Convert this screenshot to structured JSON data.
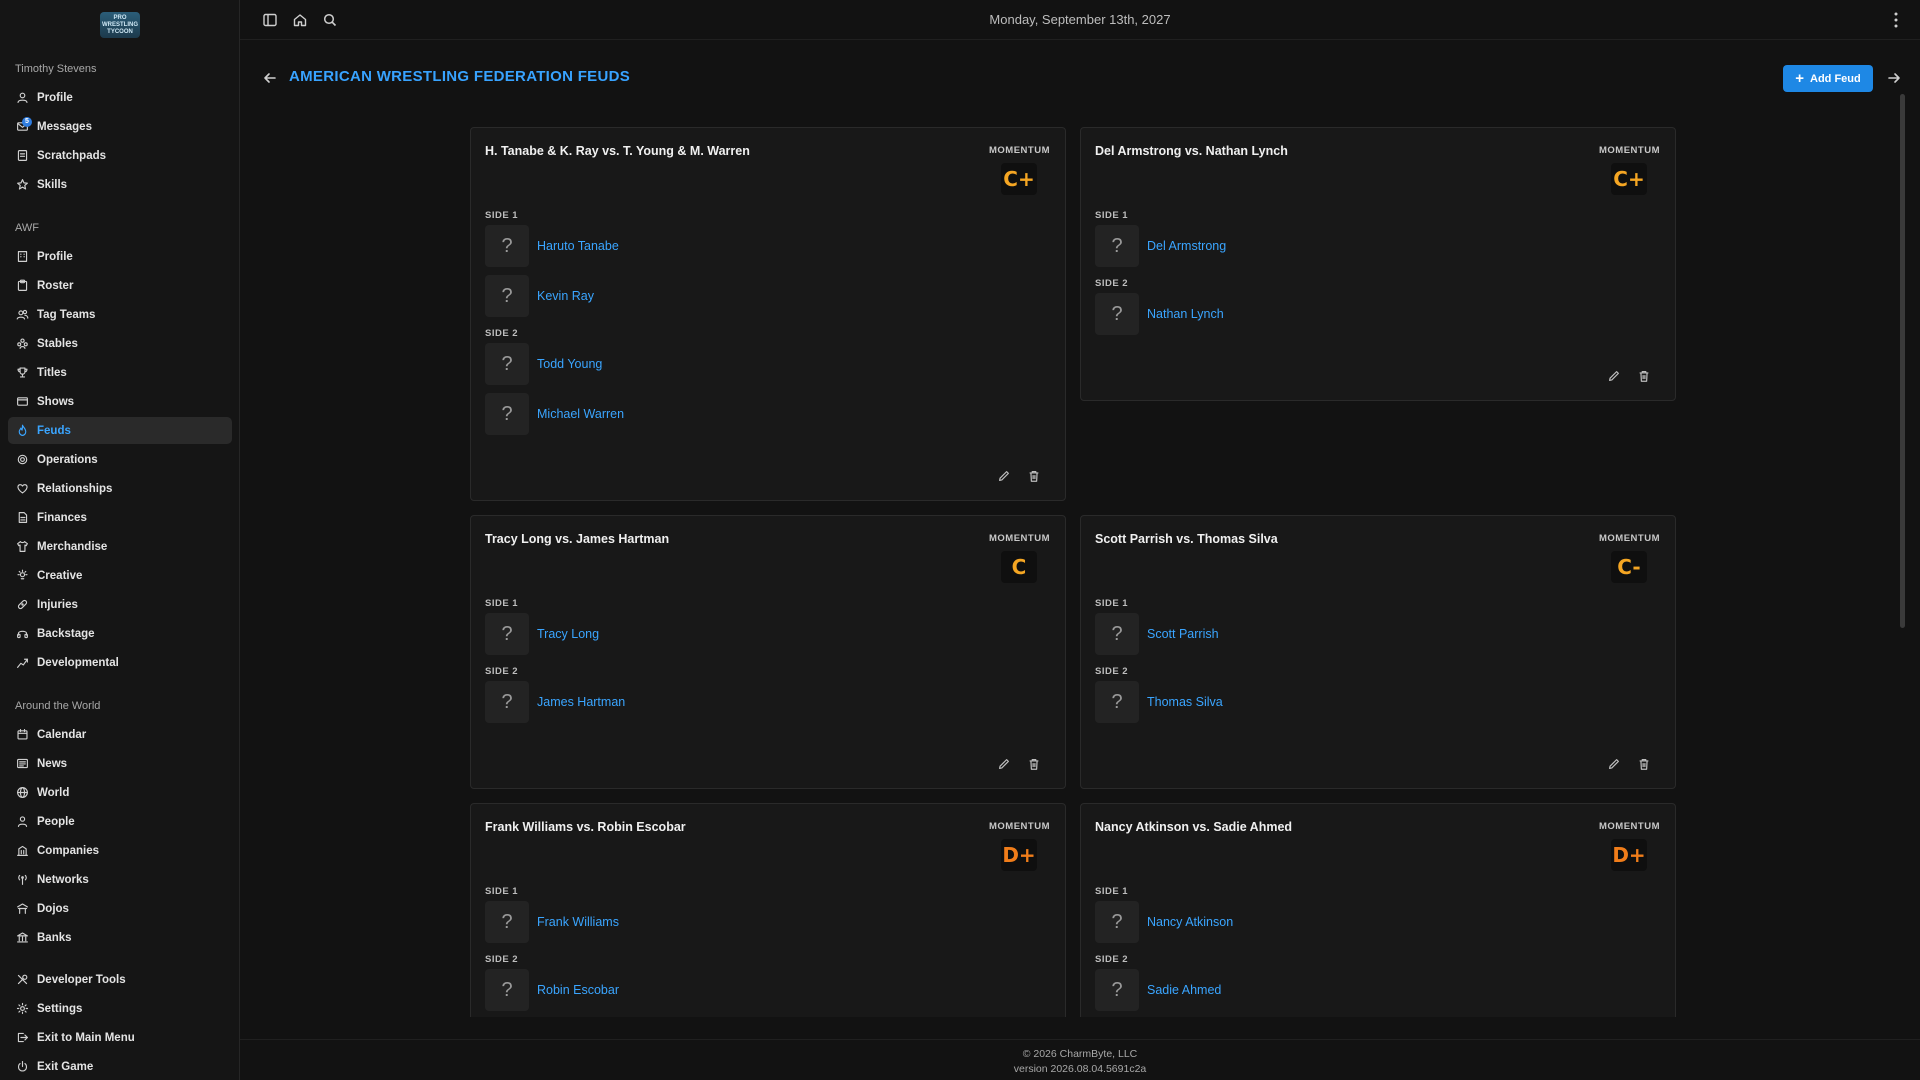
{
  "app": {
    "logo_text": "PRO WRESTLING TYCOON"
  },
  "sidebar": {
    "user_section": "Timothy Stevens",
    "user_items": [
      {
        "label": "Profile",
        "icon": "user-icon"
      },
      {
        "label": "Messages",
        "icon": "mail-icon",
        "badge": "5"
      },
      {
        "label": "Scratchpads",
        "icon": "notepad-icon"
      },
      {
        "label": "Skills",
        "icon": "star-icon"
      }
    ],
    "company_section": "AWF",
    "company_items": [
      {
        "label": "Profile",
        "icon": "building-icon"
      },
      {
        "label": "Roster",
        "icon": "clipboard-icon"
      },
      {
        "label": "Tag Teams",
        "icon": "users-icon"
      },
      {
        "label": "Stables",
        "icon": "group-icon"
      },
      {
        "label": "Titles",
        "icon": "trophy-icon"
      },
      {
        "label": "Shows",
        "icon": "tv-icon"
      },
      {
        "label": "Feuds",
        "icon": "flame-icon",
        "active": true
      },
      {
        "label": "Operations",
        "icon": "cog-icon"
      },
      {
        "label": "Relationships",
        "icon": "heart-icon"
      },
      {
        "label": "Finances",
        "icon": "document-icon"
      },
      {
        "label": "Merchandise",
        "icon": "shirt-icon"
      },
      {
        "label": "Creative",
        "icon": "bulb-icon"
      },
      {
        "label": "Injuries",
        "icon": "bandage-icon"
      },
      {
        "label": "Backstage",
        "icon": "headset-icon"
      },
      {
        "label": "Developmental",
        "icon": "trend-icon"
      }
    ],
    "world_section": "Around the World",
    "world_items": [
      {
        "label": "Calendar",
        "icon": "calendar-icon"
      },
      {
        "label": "News",
        "icon": "newspaper-icon"
      },
      {
        "label": "World",
        "icon": "globe-icon"
      },
      {
        "label": "People",
        "icon": "person-icon"
      },
      {
        "label": "Companies",
        "icon": "company-icon"
      },
      {
        "label": "Networks",
        "icon": "antenna-icon"
      },
      {
        "label": "Dojos",
        "icon": "dojo-icon"
      },
      {
        "label": "Banks",
        "icon": "bank-icon"
      }
    ],
    "bottom_items": [
      {
        "label": "Developer Tools",
        "icon": "tools-icon"
      },
      {
        "label": "Settings",
        "icon": "settings-icon"
      },
      {
        "label": "Exit to Main Menu",
        "icon": "exit-icon"
      },
      {
        "label": "Exit Game",
        "icon": "power-icon"
      }
    ]
  },
  "topbar": {
    "date": "Monday, September 13th, 2027"
  },
  "header": {
    "title": "AMERICAN WRESTLING FEDERATION FEUDS",
    "add_button": "Add Feud"
  },
  "labels": {
    "momentum": "MOMENTUM",
    "side1": "SIDE 1",
    "side2": "SIDE 2",
    "avatar_placeholder": "?"
  },
  "colors": {
    "accent": "#3aa5ff",
    "grade_c": "#f5a623",
    "grade_d": "#f07d1a"
  },
  "feuds": [
    {
      "title": "H. Tanabe & K. Ray vs. T. Young & M. Warren",
      "momentum": "C+",
      "side1": [
        "Haruto Tanabe",
        "Kevin Ray"
      ],
      "side2": [
        "Todd Young",
        "Michael Warren"
      ]
    },
    {
      "title": "Del Armstrong vs. Nathan Lynch",
      "momentum": "C+",
      "side1": [
        "Del Armstrong"
      ],
      "side2": [
        "Nathan Lynch"
      ]
    },
    {
      "title": "Tracy Long vs. James Hartman",
      "momentum": "C",
      "side1": [
        "Tracy Long"
      ],
      "side2": [
        "James Hartman"
      ]
    },
    {
      "title": "Scott Parrish vs. Thomas Silva",
      "momentum": "C-",
      "side1": [
        "Scott Parrish"
      ],
      "side2": [
        "Thomas Silva"
      ]
    },
    {
      "title": "Frank Williams vs. Robin Escobar",
      "momentum": "D+",
      "side1": [
        "Frank Williams"
      ],
      "side2": [
        "Robin Escobar"
      ]
    },
    {
      "title": "Nancy Atkinson vs. Sadie Ahmed",
      "momentum": "D+",
      "side1": [
        "Nancy Atkinson"
      ],
      "side2": [
        "Sadie Ahmed"
      ]
    }
  ],
  "footer": {
    "copyright": "© 2026 CharmByte, LLC",
    "version": "version 2026.08.04.5691c2a"
  }
}
